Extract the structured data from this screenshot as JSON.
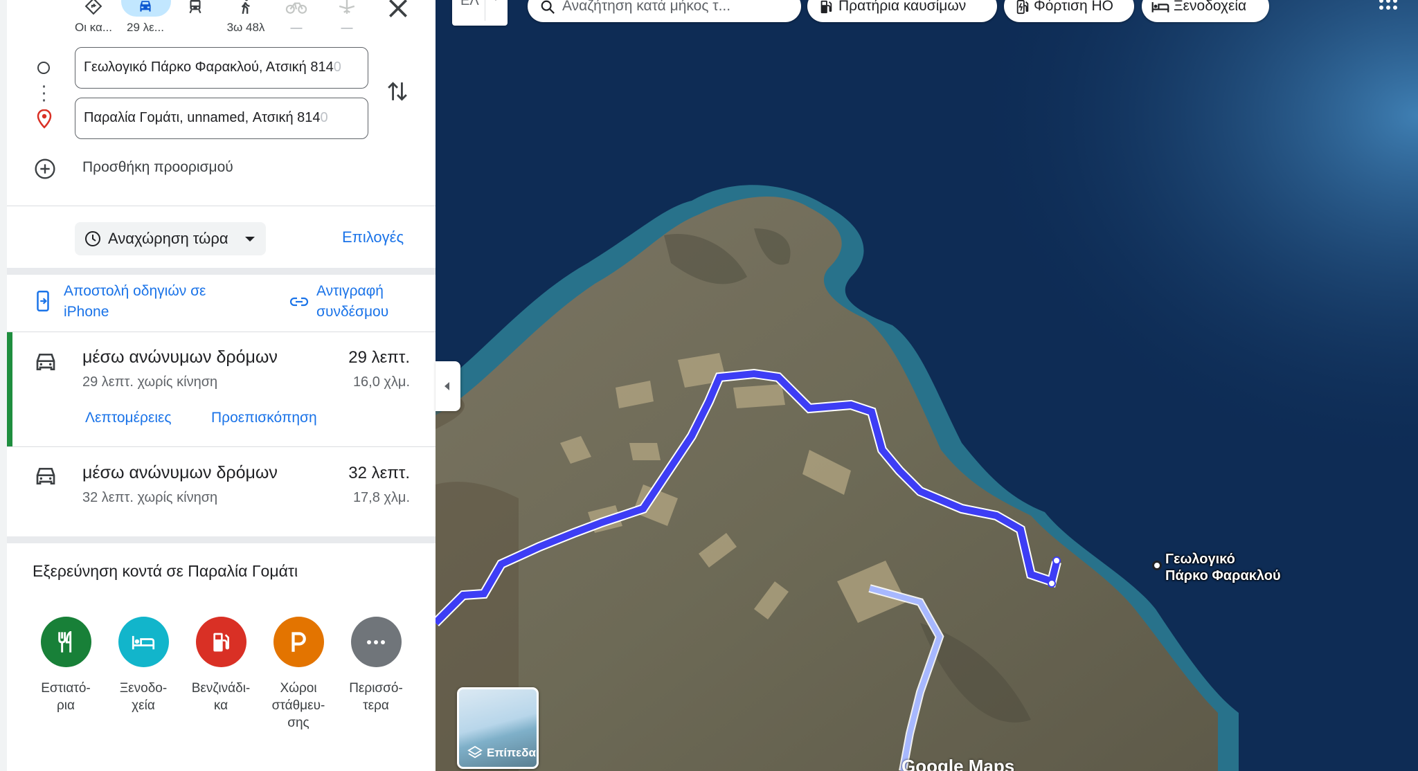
{
  "travel_modes": [
    {
      "label": "Οι κα...",
      "icon": "directions-diamond-icon"
    },
    {
      "label": "29 λε...",
      "icon": "car-icon",
      "selected": true
    },
    {
      "label": "",
      "icon": "transit-icon"
    },
    {
      "label": "3ω 48λ",
      "icon": "walk-icon"
    },
    {
      "label": "—",
      "icon": "bicycle-icon"
    },
    {
      "label": "—",
      "icon": "flight-icon"
    }
  ],
  "waypoints": {
    "origin": "Γεωλογικό Πάρκο Φαρακλού, Ατσική 814",
    "origin_fade": "0",
    "destination": "Παραλία Γομάτι, unnamed, Ατσική 814",
    "destination_fade": "0",
    "add_destination": "Προσθήκη προορισμού"
  },
  "departure": {
    "label": "Αναχώρηση τώρα",
    "options": "Επιλογές"
  },
  "share": {
    "send_to_phone": "Αποστολή οδηγιών σε iPhone",
    "copy_link": "Αντιγραφή συνδέσμου"
  },
  "routes": [
    {
      "name": "μέσω ανώνυμων δρόμων",
      "time": "29 λεπτ.",
      "traffic": "29 λεπτ. χωρίς κίνηση",
      "distance": "16,0 χλμ.",
      "details": "Λεπτομέρειες",
      "preview": "Προεπισκόπηση",
      "selected": true
    },
    {
      "name": "μέσω ανώνυμων δρόμων",
      "time": "32 λεπτ.",
      "traffic": "32 λεπτ. χωρίς κίνηση",
      "distance": "17,8 χλμ."
    }
  ],
  "explore": {
    "title": "Εξερεύνηση κοντά σε Παραλία Γομάτι",
    "categories": [
      {
        "label_line1": "Εστιατό-",
        "label_line2": "ρια",
        "label_line3": "",
        "color": "#188038",
        "icon": "restaurant-icon"
      },
      {
        "label_line1": "Ξενοδο-",
        "label_line2": "χεία",
        "label_line3": "",
        "color": "#12b5cb",
        "icon": "hotel-icon"
      },
      {
        "label_line1": "Βενζινάδι-",
        "label_line2": "κα",
        "label_line3": "",
        "color": "#d93025",
        "icon": "gas-station-icon"
      },
      {
        "label_line1": "Χώροι",
        "label_line2": "στάθμευ-",
        "label_line3": "σης",
        "color": "#e37400",
        "icon": "parking-icon"
      },
      {
        "label_line1": "Περισσό-",
        "label_line2": "τερα",
        "label_line3": "",
        "color": "#70757a",
        "icon": "more-icon"
      }
    ]
  },
  "map": {
    "language": "ΕΛ",
    "search_placeholder": "Αναζήτηση κατά μήκος τ...",
    "chips": {
      "fuel": "Πρατήρια καυσίμων",
      "ev": "Φόρτιση ΗΟ",
      "hotels": "Ξενοδοχεία"
    },
    "layers_label": "Επίπεδα",
    "place_label_line1": "Γεωλογικό",
    "place_label_line2": "Πάρκο Φαρακλού",
    "watermark": "Google Maps",
    "route_color": "#3d3df5",
    "alt_route_color": "#a7b8ff"
  }
}
